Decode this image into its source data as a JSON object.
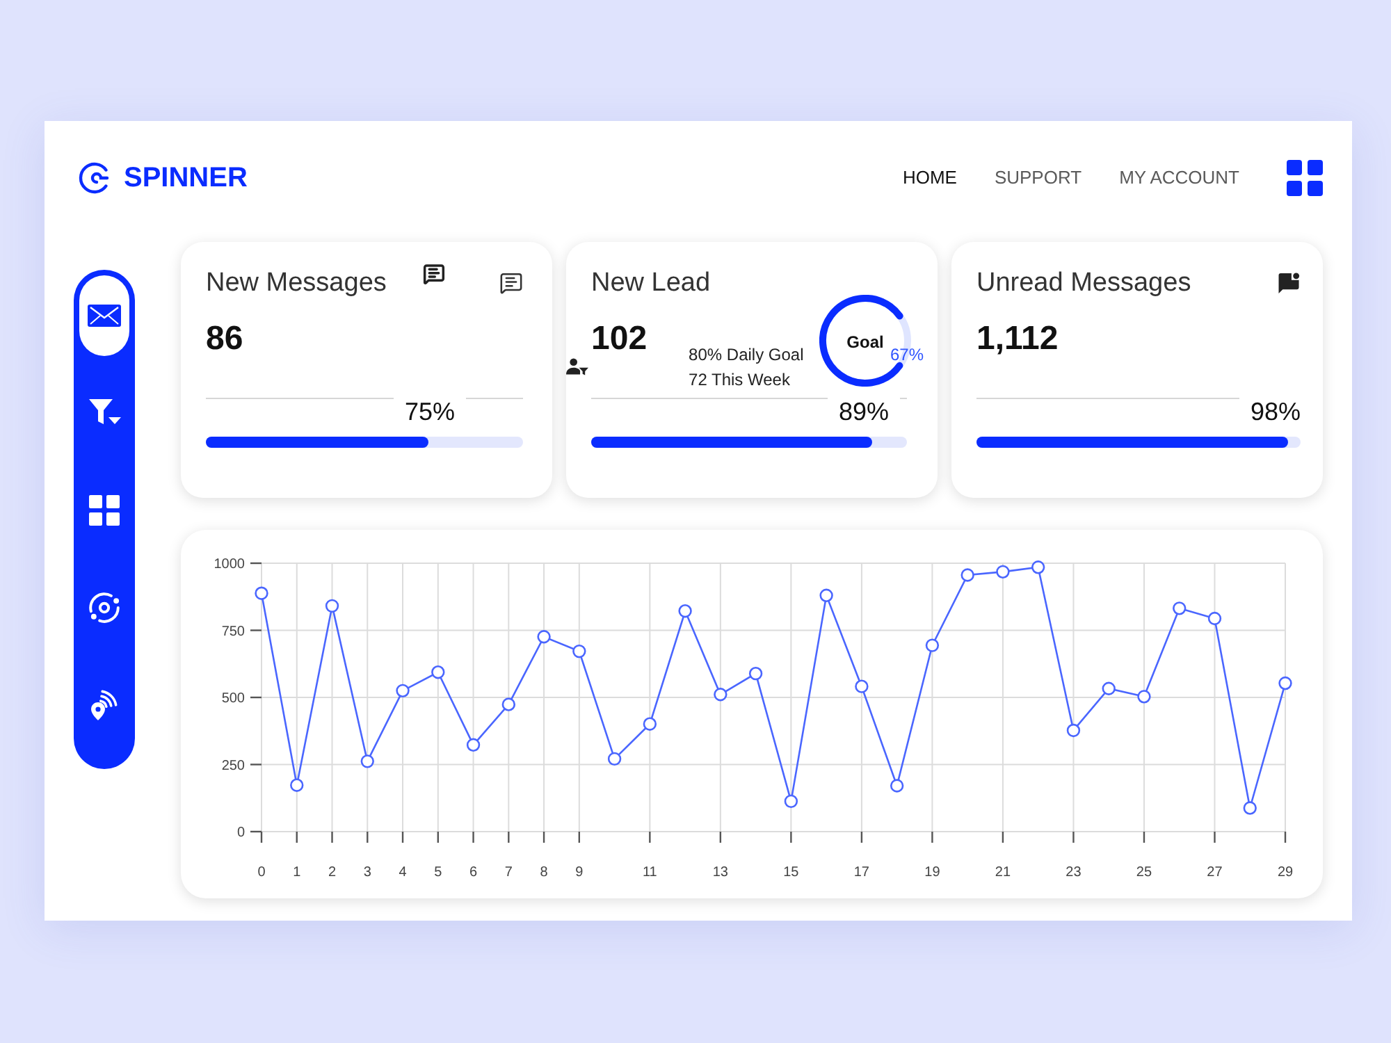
{
  "brand": {
    "name": "SPINNER"
  },
  "nav": [
    {
      "label": "HOME",
      "selected": true
    },
    {
      "label": "SUPPORT",
      "selected": false
    },
    {
      "label": "MY ACCOUNT",
      "selected": false
    }
  ],
  "sidebar": {
    "items": [
      {
        "kind": "mail",
        "selected": true
      },
      {
        "kind": "filter",
        "selected": false
      },
      {
        "kind": "grid",
        "selected": false
      },
      {
        "kind": "focus",
        "selected": false
      },
      {
        "kind": "location",
        "selected": false
      }
    ]
  },
  "cards": [
    {
      "kind": "messages",
      "title": "New Messages",
      "value": "86",
      "percent": "75%",
      "level": 0.7
    },
    {
      "kind": "lead",
      "title": "New Lead",
      "value": "102",
      "notes": [
        "80% Daily Goal",
        "72 This Week"
      ],
      "goal": {
        "label": "Goal",
        "percent": "67%",
        "level": 0.8
      },
      "percent": "89%",
      "level": 0.89
    },
    {
      "kind": "unread",
      "title": "Unread Messages",
      "value": "1,112",
      "percent": "98%",
      "level": 0.96
    }
  ],
  "chart": {
    "chart_data": {
      "type": "line",
      "grid": true,
      "x": [
        0,
        1,
        2,
        3,
        4,
        5,
        6,
        7,
        8,
        9,
        10,
        11,
        12,
        13,
        14,
        15,
        16,
        17,
        18,
        19,
        20,
        21,
        22,
        23,
        24,
        25,
        26,
        27,
        28,
        29
      ],
      "series": [
        {
          "color": "#4a66ff",
          "marker": "circle",
          "values": [
            888,
            173,
            841,
            262,
            525,
            594,
            323,
            474,
            726,
            672,
            271,
            401,
            822,
            511,
            589,
            113,
            880,
            541,
            171,
            694,
            956,
            968,
            985,
            377,
            533,
            503,
            832,
            794,
            88,
            553
          ]
        }
      ],
      "xlim": [
        0,
        29
      ],
      "ylim": [
        0,
        1000
      ],
      "xticks": [
        0,
        1,
        2,
        3,
        4,
        5,
        6,
        7,
        8,
        9,
        11,
        13,
        15,
        17,
        19,
        21,
        23,
        25,
        27,
        29
      ],
      "yticks": [
        0,
        250,
        500,
        750,
        1000
      ]
    }
  }
}
